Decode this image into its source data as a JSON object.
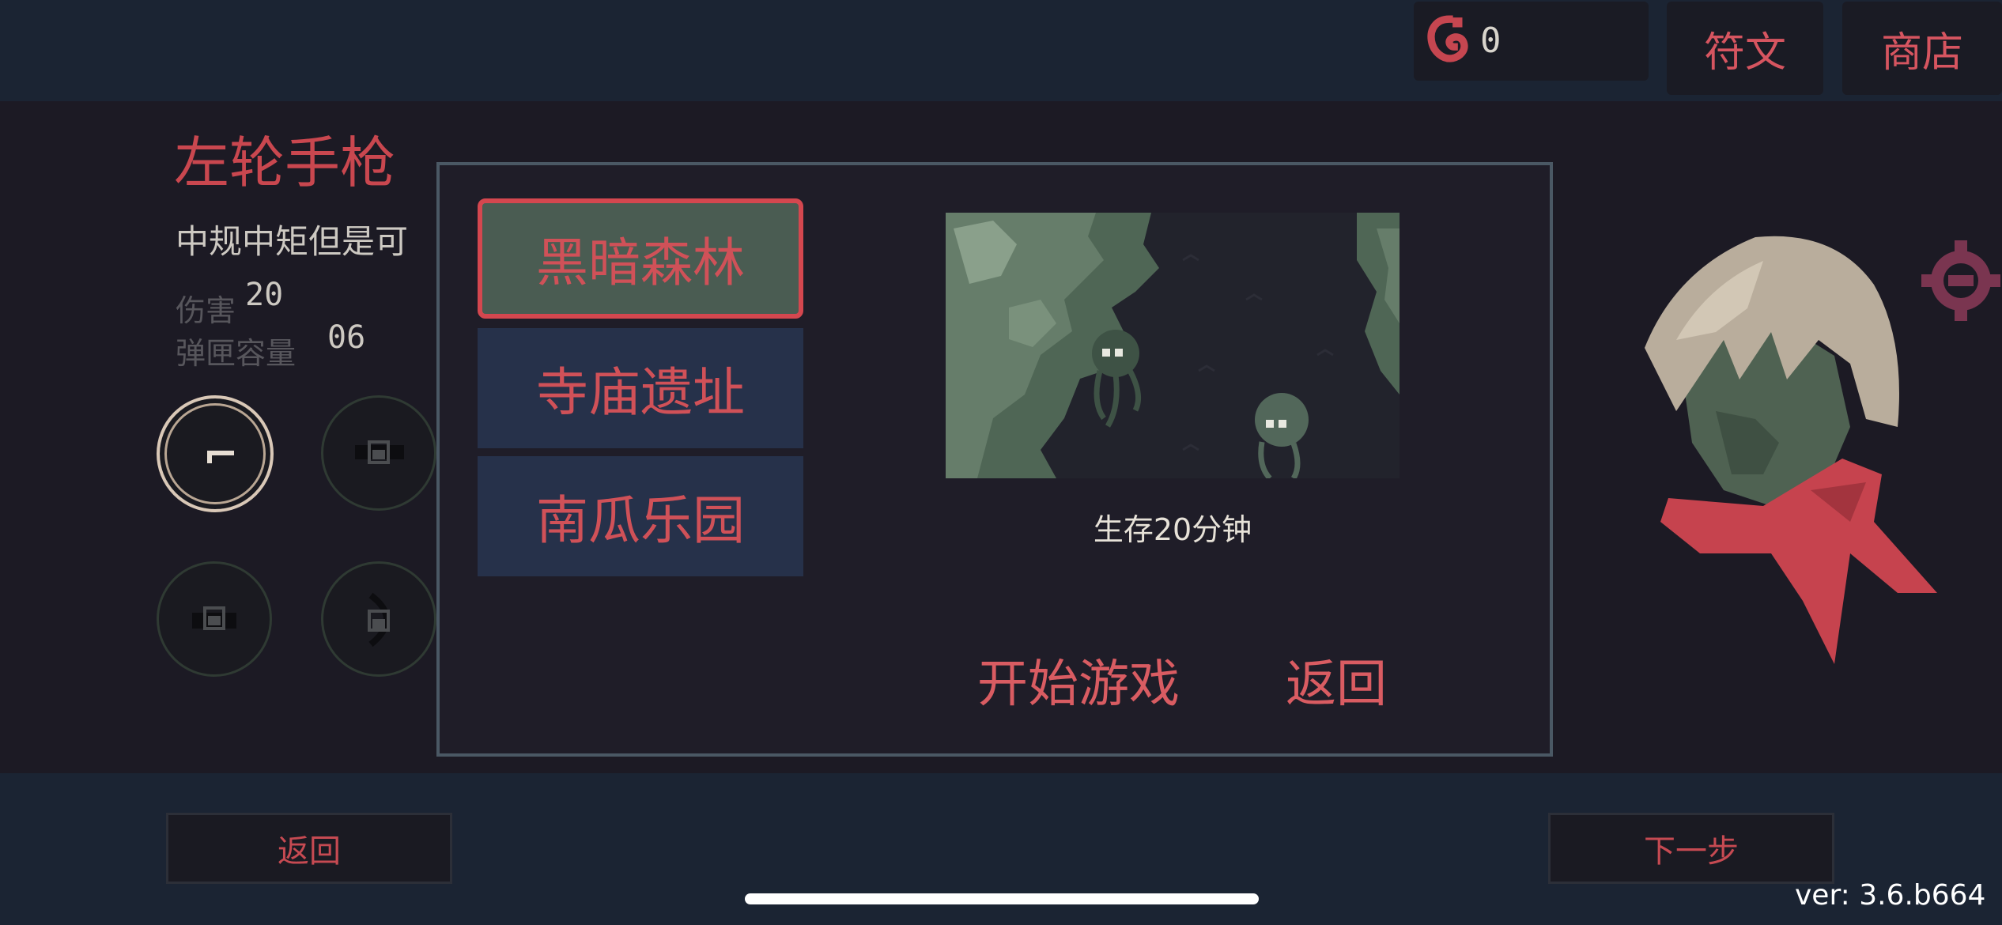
{
  "header": {
    "currency_value": "0",
    "rune_button": "符文",
    "shop_button": "商店"
  },
  "weapon": {
    "name": "左轮手枪",
    "description": "中规中矩但是可",
    "stats": [
      {
        "label": "伤害",
        "value": "20"
      },
      {
        "label": "弹匣容量",
        "value": "06"
      }
    ]
  },
  "map_select": {
    "maps": [
      {
        "name": "黑暗森林",
        "selected": true
      },
      {
        "name": "寺庙遗址",
        "selected": false
      },
      {
        "name": "南瓜乐园",
        "selected": false
      }
    ],
    "objective": "生存20分钟",
    "start_button": "开始游戏",
    "back_button": "返回"
  },
  "footer": {
    "back_button": "返回",
    "next_button": "下一步"
  },
  "version": "ver: 3.6.b664",
  "colors": {
    "accent_red": "#d4474f",
    "selected_map_bg": "#4a5c52",
    "map_bg": "#26314a",
    "topbar_bg": "#1b2433"
  }
}
